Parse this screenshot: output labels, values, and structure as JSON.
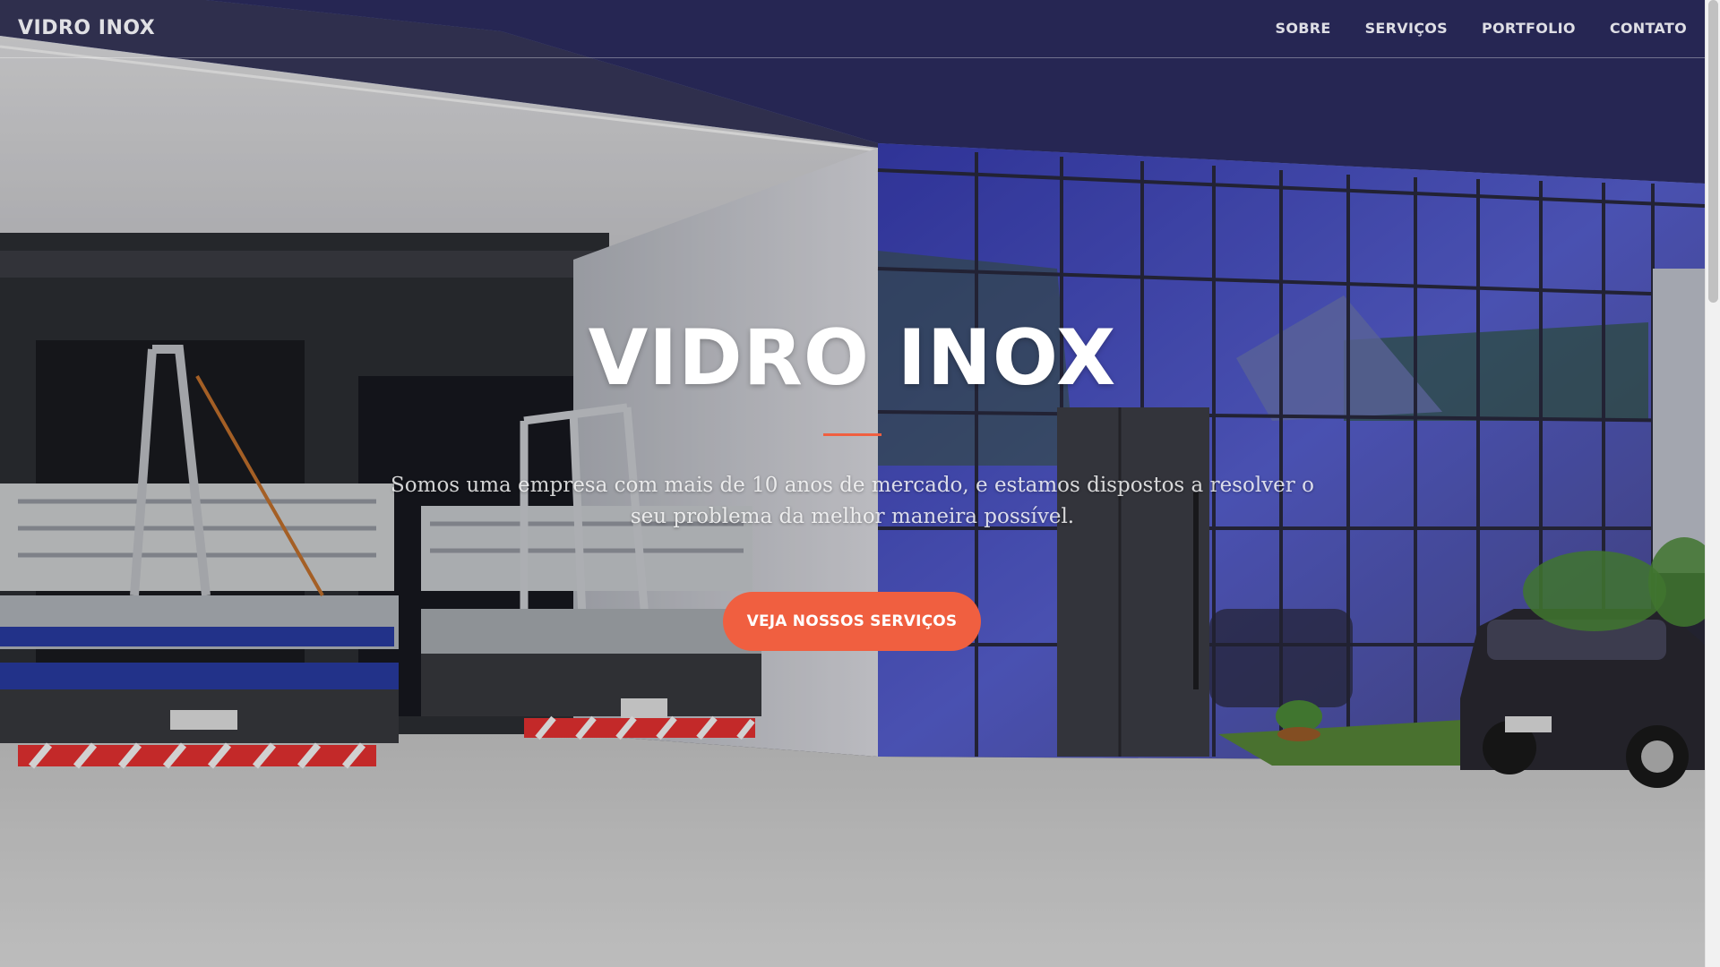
{
  "navbar": {
    "brand": "VIDRO INOX",
    "links": [
      {
        "label": "SOBRE"
      },
      {
        "label": "SERVIÇOS"
      },
      {
        "label": "PORTFOLIO"
      },
      {
        "label": "CONTATO"
      }
    ]
  },
  "hero": {
    "title": "VIDRO INOX",
    "subtitle": "Somos uma empresa com mais de 10 anos de mercado, e estamos dispostos a resolver o seu problema da melhor maneira possível.",
    "button_label": "VEJA NOSSOS SERVIÇOS"
  },
  "colors": {
    "accent": "#f05f40",
    "text_light": "#ffffff"
  },
  "background": {
    "depicts": "building-with-glass-facade-trucks-and-cars"
  }
}
